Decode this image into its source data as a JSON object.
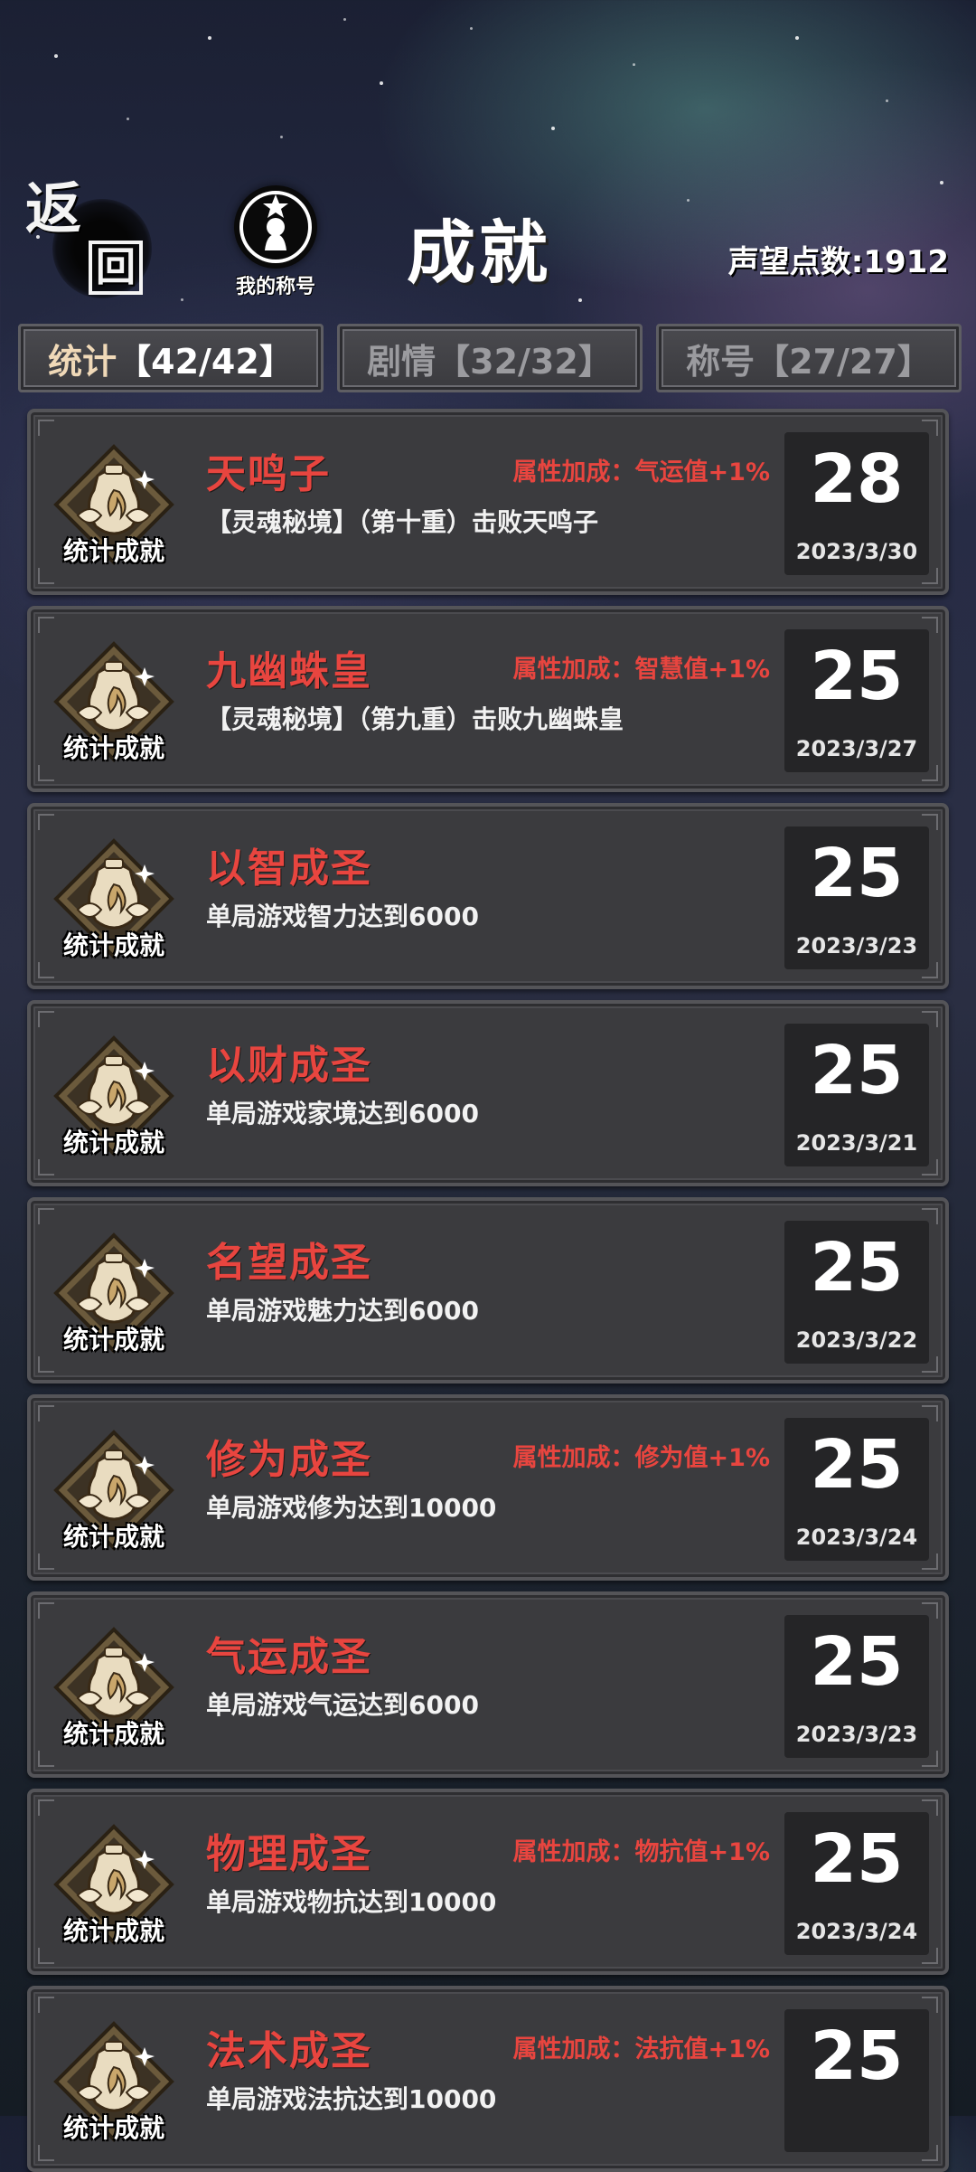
{
  "header": {
    "back_label_1": "返",
    "back_label_2": "回",
    "my_title_label": "我的称号",
    "page_title": "成就",
    "prestige": "声望点数:1912"
  },
  "tabs": [
    {
      "name": "统计",
      "count": "【42/42】",
      "active": true
    },
    {
      "name": "剧情",
      "count": "【32/32】",
      "active": false
    },
    {
      "name": "称号",
      "count": "【27/27】",
      "active": false
    }
  ],
  "colors": {
    "accent_red": "#e8453f",
    "card_bg": "#3b3b3e",
    "tab_active_text": "#f0d9b8"
  },
  "achievements": [
    {
      "badge": "统计成就",
      "name": "天鸣子",
      "bonus": "属性加成：气运值+1%",
      "desc": "【灵魂秘境】（第十重）击败天鸣子",
      "points": "28",
      "date": "2023/3/30"
    },
    {
      "badge": "统计成就",
      "name": "九幽蛛皇",
      "bonus": "属性加成：智慧值+1%",
      "desc": "【灵魂秘境】（第九重）击败九幽蛛皇",
      "points": "25",
      "date": "2023/3/27"
    },
    {
      "badge": "统计成就",
      "name": "以智成圣",
      "bonus": "",
      "desc": "单局游戏智力达到6000",
      "points": "25",
      "date": "2023/3/23"
    },
    {
      "badge": "统计成就",
      "name": "以财成圣",
      "bonus": "",
      "desc": "单局游戏家境达到6000",
      "points": "25",
      "date": "2023/3/21"
    },
    {
      "badge": "统计成就",
      "name": "名望成圣",
      "bonus": "",
      "desc": "单局游戏魅力达到6000",
      "points": "25",
      "date": "2023/3/22"
    },
    {
      "badge": "统计成就",
      "name": "修为成圣",
      "bonus": "属性加成：修为值+1%",
      "desc": "单局游戏修为达到10000",
      "points": "25",
      "date": "2023/3/24"
    },
    {
      "badge": "统计成就",
      "name": "气运成圣",
      "bonus": "",
      "desc": "单局游戏气运达到6000",
      "points": "25",
      "date": "2023/3/23"
    },
    {
      "badge": "统计成就",
      "name": "物理成圣",
      "bonus": "属性加成：物抗值+1%",
      "desc": "单局游戏物抗达到10000",
      "points": "25",
      "date": "2023/3/24"
    },
    {
      "badge": "统计成就",
      "name": "法术成圣",
      "bonus": "属性加成：法抗值+1%",
      "desc": "单局游戏法抗达到10000",
      "points": "25",
      "date": ""
    }
  ]
}
